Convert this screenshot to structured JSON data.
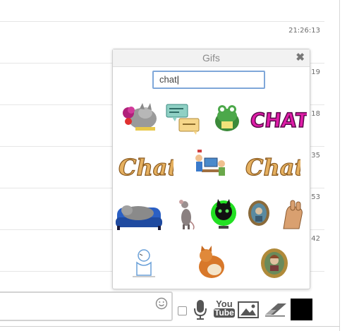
{
  "messages": [
    {
      "time": "21:26:13"
    },
    {
      "time": "7:19"
    },
    {
      "time": "3:18"
    },
    {
      "time": "5:35"
    },
    {
      "time": "0:53"
    },
    {
      "time": "3:42"
    }
  ],
  "gif_panel": {
    "title": "Gifs",
    "close": "✖",
    "search_value": "chat",
    "gifs": [
      {
        "name": "cat-with-flowers"
      },
      {
        "name": "speech-bubbles"
      },
      {
        "name": "green-frog"
      },
      {
        "name": "chat-pink-text"
      },
      {
        "name": "chat-gold-text"
      },
      {
        "name": "people-at-computer"
      },
      {
        "name": "chat-gold-text-2"
      },
      {
        "name": "cat-on-blue-sofa"
      },
      {
        "name": "rat-standing"
      },
      {
        "name": "black-cat-hero"
      },
      {
        "name": "framed-portrait"
      },
      {
        "name": "waving-hand"
      },
      {
        "name": "sketch-character"
      },
      {
        "name": "orange-cat"
      },
      {
        "name": "framed-lady"
      }
    ]
  },
  "toolbar": {
    "youtube_top": "You",
    "youtube_bottom": "Tube",
    "color": "#000000"
  }
}
